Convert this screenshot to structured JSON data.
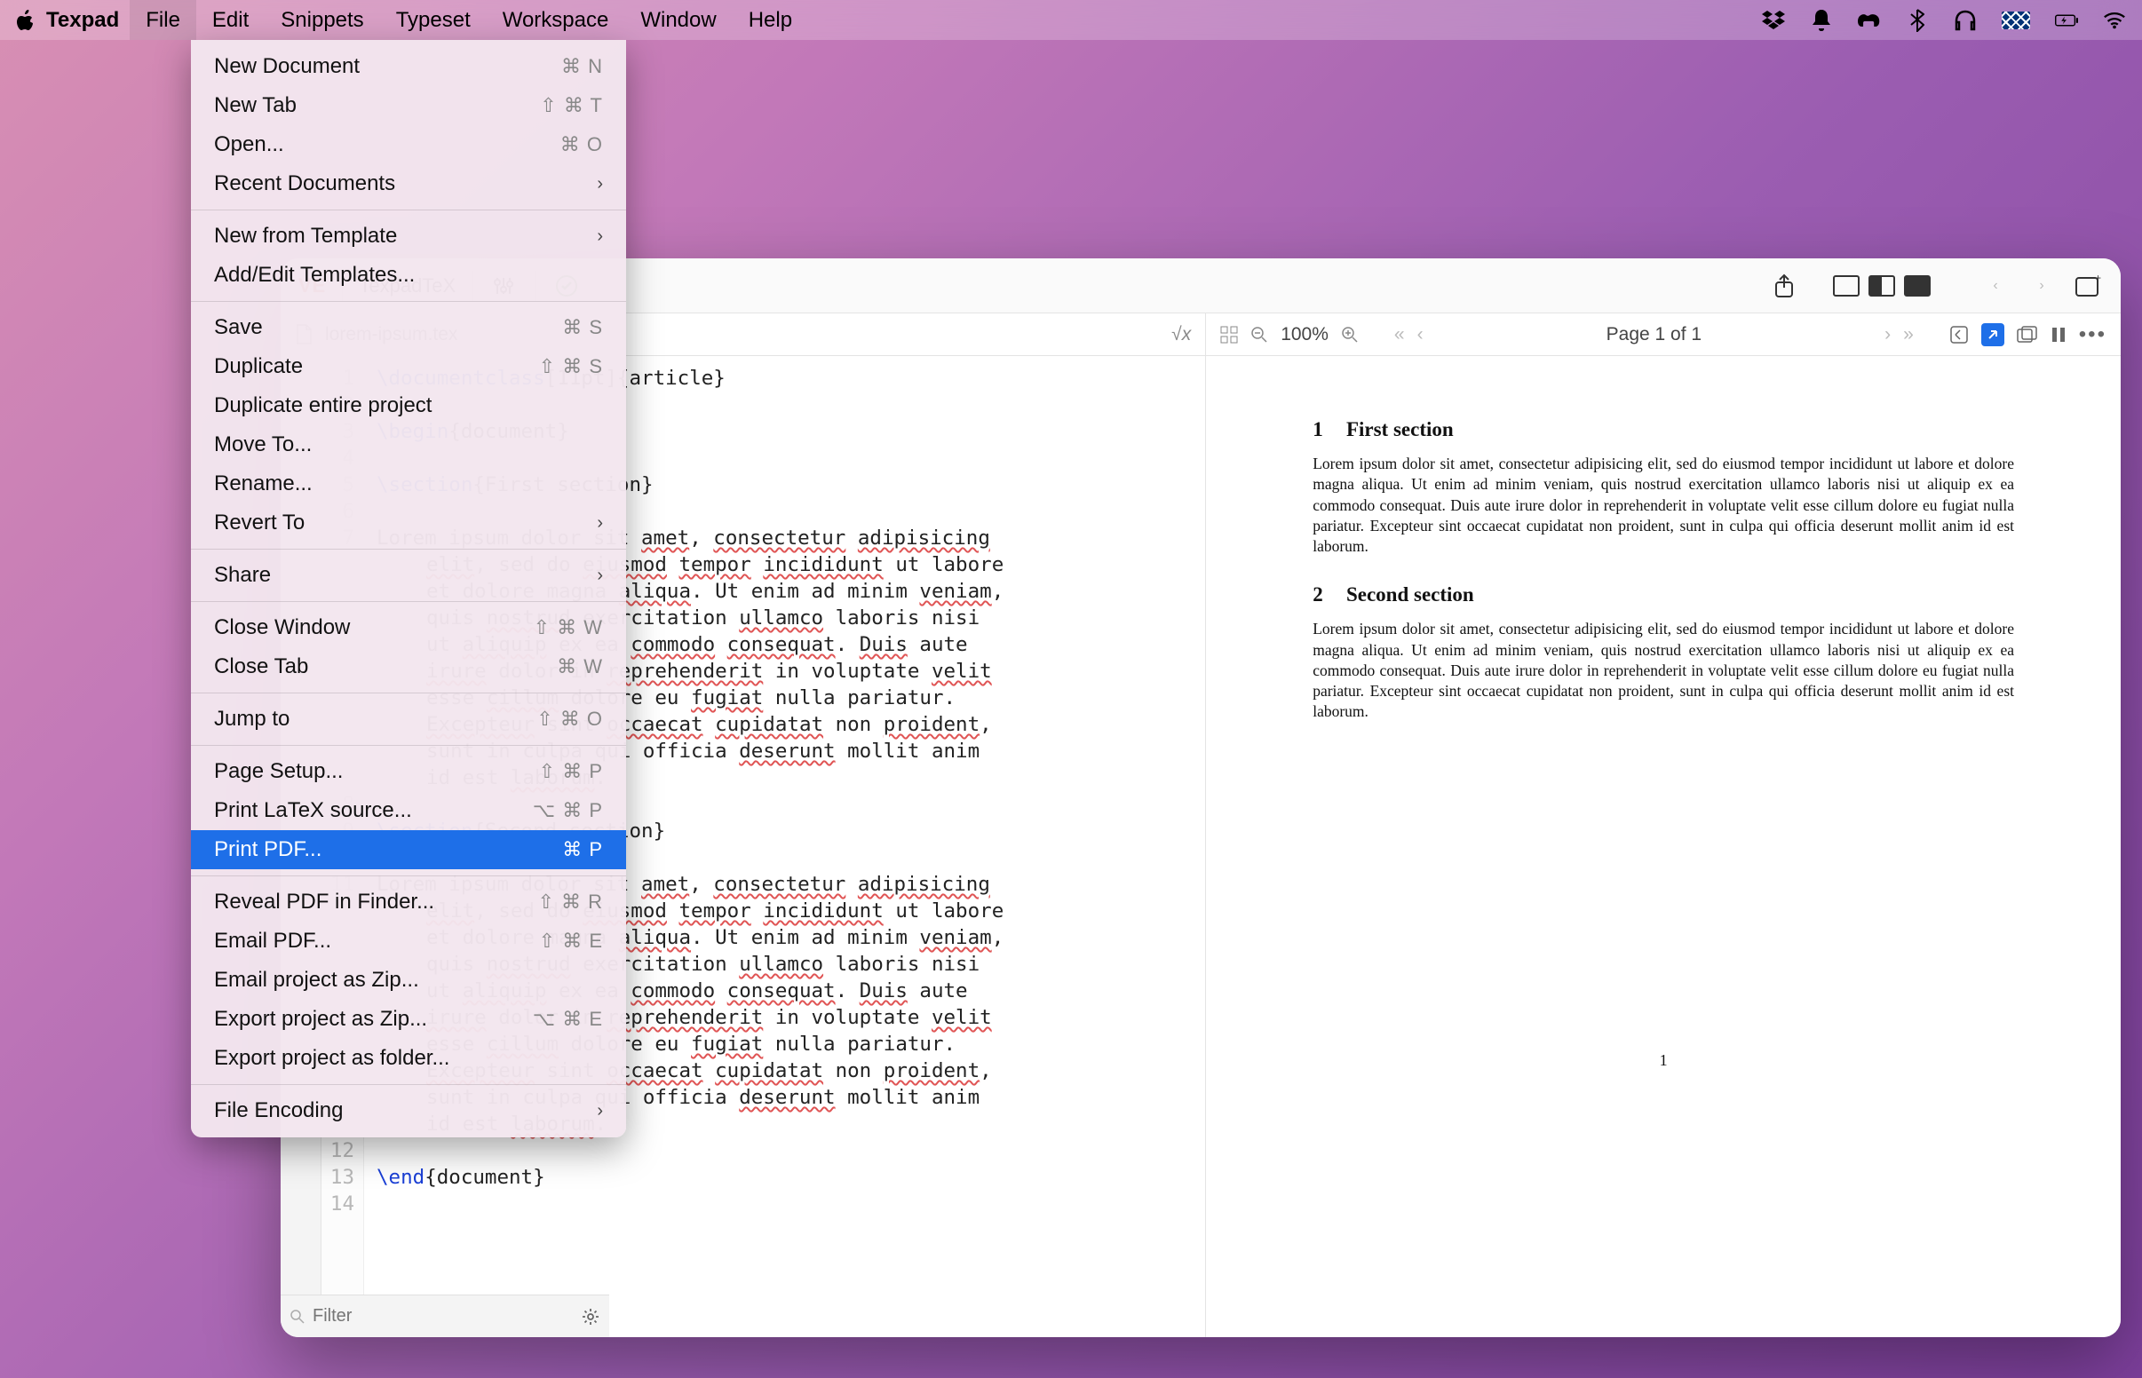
{
  "menubar": {
    "app": "Texpad",
    "items": [
      "File",
      "Edit",
      "Snippets",
      "Typeset",
      "Workspace",
      "Window",
      "Help"
    ],
    "active": "File"
  },
  "dropdown": {
    "groups": [
      [
        {
          "label": "New Document",
          "shortcut": "⌘ N"
        },
        {
          "label": "New Tab",
          "shortcut": "⇧ ⌘ T"
        },
        {
          "label": "Open...",
          "shortcut": "⌘ O"
        },
        {
          "label": "Recent Documents",
          "submenu": true
        }
      ],
      [
        {
          "label": "New from Template",
          "submenu": true
        },
        {
          "label": "Add/Edit Templates..."
        }
      ],
      [
        {
          "label": "Save",
          "shortcut": "⌘ S"
        },
        {
          "label": "Duplicate",
          "shortcut": "⇧ ⌘ S"
        },
        {
          "label": "Duplicate entire project"
        },
        {
          "label": "Move To..."
        },
        {
          "label": "Rename..."
        },
        {
          "label": "Revert To",
          "submenu": true
        }
      ],
      [
        {
          "label": "Share",
          "submenu": true
        }
      ],
      [
        {
          "label": "Close Window",
          "shortcut": "⇧ ⌘ W"
        },
        {
          "label": "Close Tab",
          "shortcut": "⌘ W"
        }
      ],
      [
        {
          "label": "Jump to",
          "shortcut": "⇧ ⌘ O"
        }
      ],
      [
        {
          "label": "Page Setup...",
          "shortcut": "⇧ ⌘ P"
        },
        {
          "label": "Print LaTeX source...",
          "shortcut": "⌥ ⌘ P"
        },
        {
          "label": "Print PDF...",
          "shortcut": "⌘ P",
          "selected": true
        }
      ],
      [
        {
          "label": "Reveal PDF in Finder...",
          "shortcut": "⇧ ⌘ R"
        },
        {
          "label": "Email PDF...",
          "shortcut": "⇧ ⌘ E"
        },
        {
          "label": "Email project as Zip..."
        },
        {
          "label": "Export project as Zip...",
          "shortcut": "⌥ ⌘ E"
        },
        {
          "label": "Export project as folder..."
        }
      ],
      [
        {
          "label": "File Encoding",
          "submenu": true
        }
      ]
    ]
  },
  "window": {
    "live_badge": "VE",
    "engine": "TexpadTeX",
    "filename": "lorem-ipsum.tex",
    "zoom": "100%",
    "page_indicator": "Page 1 of 1",
    "filter_placeholder": "Filter"
  },
  "code": {
    "lines": [
      {
        "n": 1,
        "type": "cmd",
        "cmd": "\\documentclass",
        "rest": "[11pt]{article}"
      },
      {
        "n": 2,
        "type": "blank"
      },
      {
        "n": 3,
        "type": "cmd",
        "cmd": "\\begin",
        "rest": "{document}"
      },
      {
        "n": 4,
        "type": "blank"
      },
      {
        "n": 5,
        "type": "cmd",
        "cmd": "\\section",
        "rest": "{First section}"
      },
      {
        "n": 6,
        "type": "blank"
      },
      {
        "n": 7,
        "type": "para"
      },
      {
        "n": 8,
        "type": "blank"
      },
      {
        "n": 9,
        "type": "cmd",
        "cmd": "\\section",
        "rest": "{Second section}"
      },
      {
        "n": 10,
        "type": "blank"
      },
      {
        "n": 11,
        "type": "para"
      },
      {
        "n": 12,
        "type": "blank"
      },
      {
        "n": 13,
        "type": "cmd",
        "cmd": "\\end",
        "rest": "{document}"
      },
      {
        "n": 14,
        "type": "blank"
      }
    ],
    "para_first": "Lorem ipsum dolor sit amet, consectetur adipisicing",
    "para_wraps": [
      "elit, sed do eiusmod tempor incididunt ut labore",
      "et dolore magna aliqua. Ut enim ad minim veniam,",
      "quis nostrud exercitation ullamco laboris nisi",
      "ut aliquip ex ea commodo consequat. Duis aute",
      "irure dolor in reprehenderit in voluptate velit",
      "esse cillum dolore eu fugiat nulla pariatur.",
      "Excepteur sint occaecat cupidatat non proident,",
      "sunt in culpa qui officia deserunt mollit anim",
      "id est laborum."
    ],
    "spellwords": [
      "amet",
      "consectetur",
      "adipisicing",
      "elit",
      "eiusmod",
      "tempor",
      "incididunt",
      "aliqua",
      "veniam",
      "nostrud",
      "ullamco",
      "aliquip",
      "commodo",
      "consequat",
      "Duis",
      "irure",
      "reprehenderit",
      "velit",
      "cillum",
      "fugiat",
      "Excepteur",
      "occaecat",
      "cupidatat",
      "proident",
      "deserunt",
      "laborum"
    ]
  },
  "preview": {
    "sections": [
      {
        "num": "1",
        "title": "First section"
      },
      {
        "num": "2",
        "title": "Second section"
      }
    ],
    "paragraph": "Lorem ipsum dolor sit amet, consectetur adipisicing elit, sed do eiusmod tempor incididunt ut labore et dolore magna aliqua. Ut enim ad minim veniam, quis nostrud exercitation ullamco laboris nisi ut aliquip ex ea commodo consequat. Duis aute irure dolor in reprehenderit in voluptate velit esse cillum dolore eu fugiat nulla pariatur. Excepteur sint occaecat cupidatat non proident, sunt in culpa qui officia deserunt mollit anim id est laborum.",
    "pagenum": "1"
  }
}
